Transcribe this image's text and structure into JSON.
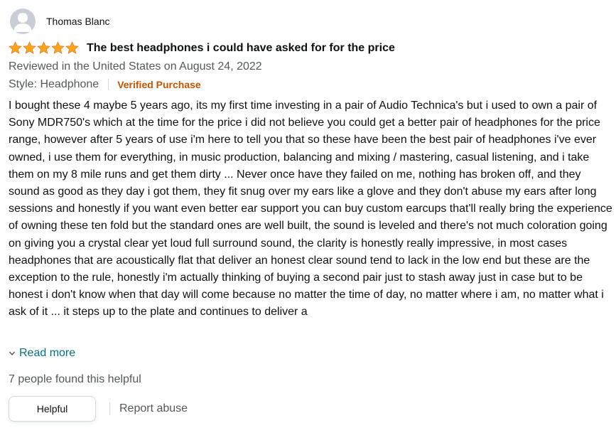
{
  "reviewer": {
    "name": "Thomas Blanc",
    "avatar_icon": "default-user-avatar-icon"
  },
  "rating": {
    "stars": 5,
    "max": 5,
    "star_color": "#ffa41c"
  },
  "review": {
    "title": "The best headphones i could have asked for for the price",
    "date_line": "Reviewed in the United States on August 24, 2022",
    "style": "Style: Headphone",
    "verified": "Verified Purchase",
    "body": "I bought these 4 maybe 5 years ago, its my first time investing in a pair of Audio Technica's but i used to own a pair of Sony MDR750's which at the time for the price i did not believe you could get a better pair of headphones for the price range, however after 5 years of use i'm here to tell you that so these have been the best pair of headphones i've ever owned, i use them for everything, in music production, balancing and mixing / mastering, casual listening, and i take them on my 8 mile runs and get them dirty ... Never once have they failed on me, nothing has broken off, and they sound as good as they day i got them, they fit snug over my ears like a glove and they don't abuse my ears after long sessions and honestly if you want even better ear support you can buy custom earcups that'll really bring the experience of owning these ten fold but the standard ones are well built, the sound is leveled and there's not much coloration going on giving you a crystal clear yet loud full surround sound, the clarity is honestly really impressive, in most cases headphones that are acoustically flat that deliver an honest clear sound tend to lack in the low end but these are the exception to the rule, honestly i'm actually thinking of buying a second pair just to stash away just in case but to be honest i don't know when that day will come because no matter the time of day, no matter where i am, no matter what i ask of it ... it steps up to the plate and continues to deliver a"
  },
  "read_more": {
    "label": "Read more",
    "icon": "chevron-down-icon"
  },
  "helpful_count_text": "7 people found this helpful",
  "actions": {
    "helpful_label": "Helpful",
    "report_label": "Report abuse"
  },
  "colors": {
    "link": "#007185",
    "verified": "#c45500",
    "secondary_text": "#565959"
  }
}
